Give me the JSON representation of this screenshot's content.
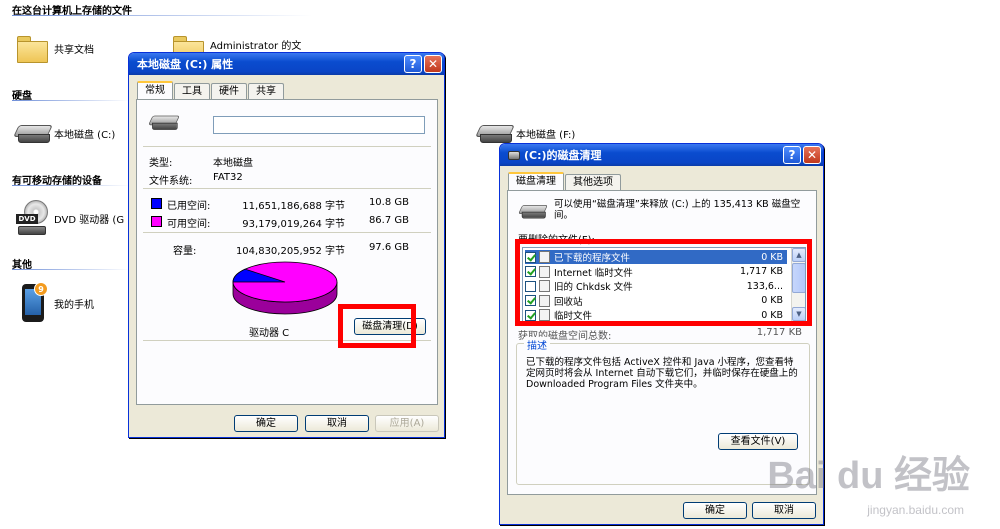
{
  "explorer": {
    "header": "在这台计算机上存储的文件",
    "shared_docs": "共享文档",
    "admin_docs": "Administrator 的文",
    "section_disks": "硬盘",
    "disk_c": "本地磁盘 (C:)",
    "disk_f": "本地磁盘 (F:)",
    "section_removable": "有可移动存储的设备",
    "dvd_drive": "DVD 驱动器 (G",
    "dvd_tag": "DVD",
    "section_other": "其他",
    "my_phone": "我的手机",
    "phone_badge": "9"
  },
  "props": {
    "title": "本地磁盘 (C:) 属性",
    "help": "?",
    "close": "✕",
    "tabs": [
      "常规",
      "工具",
      "硬件",
      "共享"
    ],
    "name_value": "",
    "type_label": "类型:",
    "type_value": "本地磁盘",
    "fs_label": "文件系统:",
    "fs_value": "FAT32",
    "used_label": "已用空间:",
    "used_bytes": "11,651,186,688 字节",
    "used_gb": "10.8 GB",
    "free_label": "可用空间:",
    "free_bytes": "93,179,019,264 字节",
    "free_gb": "86.7 GB",
    "cap_label": "容量:",
    "cap_bytes": "104,830,205,952 字节",
    "cap_gb": "97.6 GB",
    "drive_label": "驱动器 C",
    "cleanup_btn": "磁盘清理(D)",
    "ok": "确定",
    "cancel": "取消",
    "apply": "应用(A)",
    "used_color": "#0000ff",
    "free_color": "#ff00ff",
    "used_fraction": 0.111
  },
  "cleanup": {
    "title": "(C:)的磁盘清理",
    "help": "?",
    "close": "✕",
    "tabs": [
      "磁盘清理",
      "其他选项"
    ],
    "intro": "可以使用“磁盘清理”来释放 (C:) 上的 135,413 KB 磁盘空间。",
    "list_label": "要删除的文件(F):",
    "items": [
      {
        "name": "已下载的程序文件",
        "size": "0 KB",
        "checked": true,
        "selected": true
      },
      {
        "name": "Internet 临时文件",
        "size": "1,717 KB",
        "checked": true,
        "selected": false
      },
      {
        "name": "旧的 Chkdsk 文件",
        "size": "133,6...",
        "checked": false,
        "selected": false
      },
      {
        "name": "回收站",
        "size": "0 KB",
        "checked": true,
        "selected": false
      },
      {
        "name": "临时文件",
        "size": "0 KB",
        "checked": true,
        "selected": false
      }
    ],
    "total_label": "获取的磁盘空间总数:",
    "total_value": "1,717 KB",
    "desc_title": "描述",
    "description": "已下载的程序文件包括 ActiveX 控件和 Java 小程序，您查看特定网页时将会从 Internet 自动下载它们，并临时保存在硬盘上的 Downloaded Program Files 文件夹中。",
    "view_files": "查看文件(V)",
    "ok": "确定",
    "cancel": "取消"
  },
  "watermark": {
    "brand": "Bai du 经验",
    "url": "jingyan.baidu.com"
  }
}
